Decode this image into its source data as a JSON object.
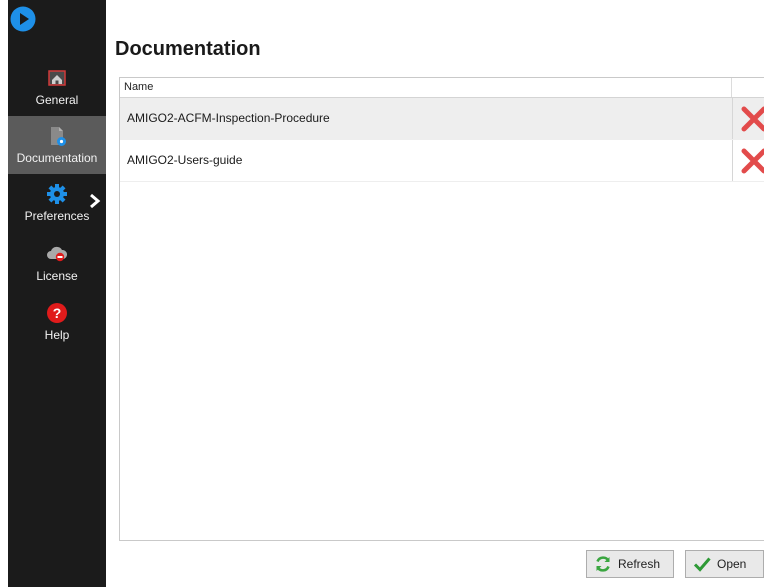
{
  "sidebar": {
    "items": [
      {
        "label": "General",
        "icon": "home-folder-icon",
        "active": false
      },
      {
        "label": "Documentation",
        "icon": "document-icon",
        "active": true
      },
      {
        "label": "Preferences",
        "icon": "gear-icon",
        "active": false
      },
      {
        "label": "License",
        "icon": "cloud-license-icon",
        "active": false
      },
      {
        "label": "Help",
        "icon": "help-icon",
        "active": false
      }
    ]
  },
  "main": {
    "title": "Documentation",
    "table": {
      "columns": [
        "Name"
      ],
      "rows": [
        {
          "name": "AMIGO2-ACFM-Inspection-Procedure",
          "selected": true
        },
        {
          "name": "AMIGO2-Users-guide",
          "selected": false
        }
      ]
    }
  },
  "footer": {
    "refresh_label": "Refresh",
    "open_label": "Open"
  },
  "colors": {
    "sidebar_bg": "#1b1b1b",
    "sidebar_active": "#5b5b5b",
    "accent_blue": "#1e90e8",
    "delete_red": "#e24b4b",
    "help_red": "#e01b1b",
    "refresh_green": "#3aa640",
    "open_green": "#2e9a36"
  }
}
